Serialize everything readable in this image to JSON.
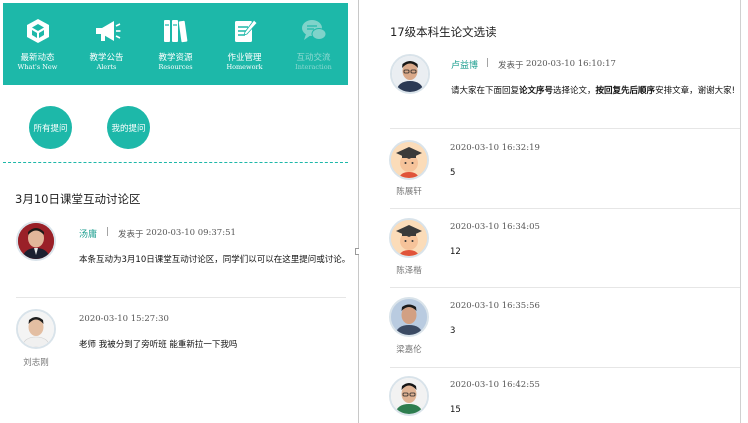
{
  "nav": [
    {
      "cn": "最新动态",
      "en": "What's New",
      "icon": "cube-icon"
    },
    {
      "cn": "教学公告",
      "en": "Alerts",
      "icon": "megaphone-icon"
    },
    {
      "cn": "教学资源",
      "en": "Resources",
      "icon": "books-icon"
    },
    {
      "cn": "作业管理",
      "en": "Homework",
      "icon": "notepad-icon"
    },
    {
      "cn": "互动交流",
      "en": "Interaction",
      "icon": "chat-icon"
    }
  ],
  "buttons": {
    "all_questions": "所有提问",
    "my_questions": "我的提问"
  },
  "left": {
    "title": "3月10日课堂互动讨论区",
    "post": {
      "author": "汤庸",
      "sep": "|",
      "posted_prefix": "发表于",
      "time": "2020-03-10 09:37:51",
      "text": "本条互动为3月10日课堂互动讨论区，同学们以可以在这里提问或讨论。"
    },
    "reply": {
      "name": "刘志刚",
      "time": "2020-03-10 15:27:30",
      "text": "老师 我被分到了旁听班 能重新拉一下我吗"
    }
  },
  "right": {
    "title": "17级本科生论文选读",
    "post": {
      "author": "卢益博",
      "sep": "|",
      "posted_prefix": "发表于",
      "time": "2020-03-10 16:10:17",
      "text_a": "请大家在下面回复",
      "text_b": "论文序号",
      "text_c": "选择论文，",
      "text_d": "按回复先后顺序",
      "text_e": "安排文章，谢谢大家!"
    },
    "replies": [
      {
        "name": "陈展轩",
        "time": "2020-03-10 16:32:19",
        "text": "5"
      },
      {
        "name": "陈泽楷",
        "time": "2020-03-10 16:34:05",
        "text": "12"
      },
      {
        "name": "梁嘉伦",
        "time": "2020-03-10 16:35:56",
        "text": "3"
      },
      {
        "name": "",
        "time": "2020-03-10 16:42:55",
        "text": "15"
      }
    ]
  },
  "colors": {
    "accent": "#1db8a9",
    "link": "#1c9e8f"
  }
}
